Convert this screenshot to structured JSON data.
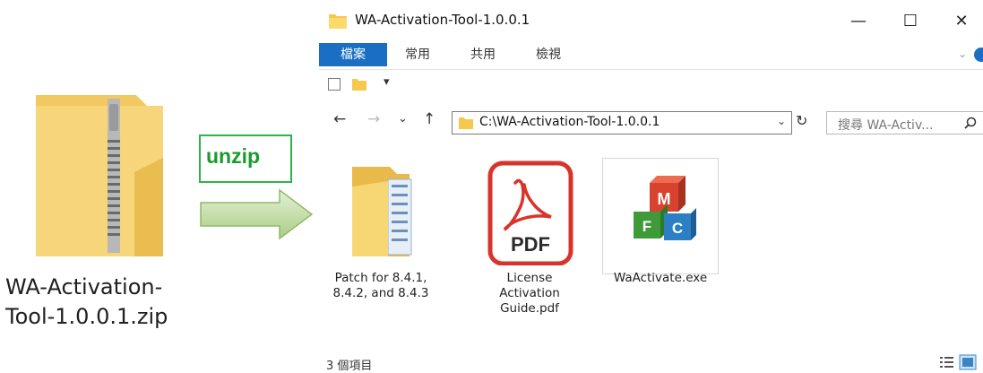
{
  "zip_file": {
    "name_line1": "WA-Activation-",
    "name_line2": "Tool-1.0.0.1.zip",
    "icon": "zip-folder-icon"
  },
  "annotation": {
    "label": "unzip",
    "arrow_icon": "right-arrow-icon",
    "label_color": "#1a9b2e",
    "arrow_color": "#bcd89a"
  },
  "window": {
    "title": "WA-Activation-Tool-1.0.0.1",
    "controls": {
      "minimize": "—",
      "maximize": "☐",
      "close": "✕"
    },
    "ribbon_tabs": [
      "檔案",
      "常用",
      "共用",
      "檢視"
    ],
    "address": "C:\\WA-Activation-Tool-1.0.0.1",
    "search_placeholder": "搜尋 WA-Activ...",
    "nav": {
      "back": "←",
      "forward": "→",
      "recent": "⌄",
      "up": "↑",
      "refresh": "↻",
      "addr_dropdown": "⌄",
      "ribbon_collapse": "⌄",
      "qat_dropdown": "▾"
    },
    "items": [
      {
        "name_lines": [
          "Patch for 8.4.1,",
          "8.4.2, and 8.4.3",
          ""
        ],
        "icon": "folder-icon"
      },
      {
        "name_lines": [
          "License",
          "Activation",
          "Guide.pdf"
        ],
        "icon": "pdf-icon",
        "badge": "PDF"
      },
      {
        "name_lines": [
          "WaActivate.exe",
          "",
          ""
        ],
        "icon": "mfc-app-icon",
        "letters": [
          "M",
          "F",
          "C"
        ]
      }
    ],
    "status": "3 個項目",
    "accent": "#1a6fc4"
  }
}
